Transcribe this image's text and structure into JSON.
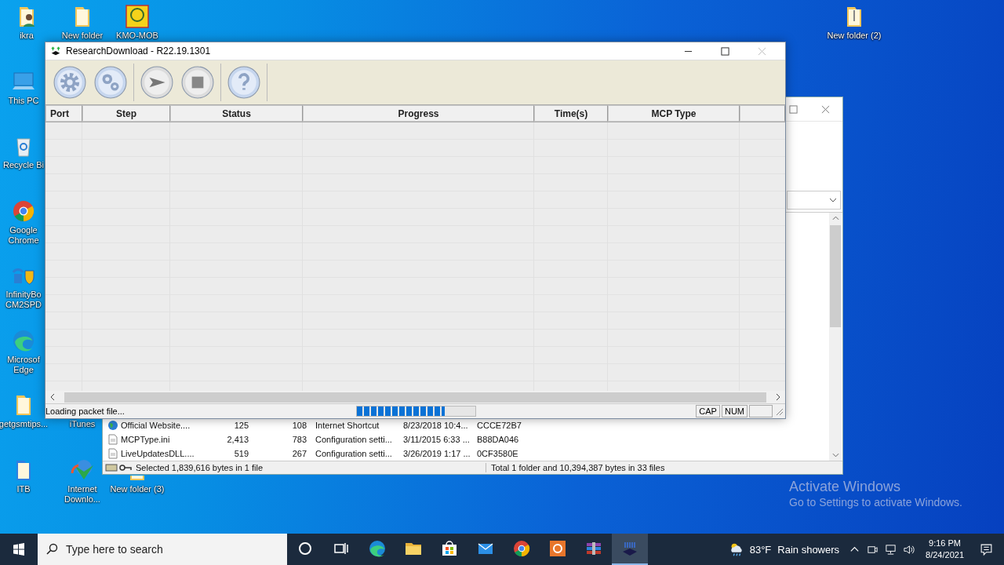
{
  "desktop_icons": [
    {
      "label": "ikra",
      "kind": "user-folder"
    },
    {
      "label": "New folder",
      "kind": "folder"
    },
    {
      "label": "KMO-MOB",
      "kind": "yellow-app"
    },
    {
      "label": "New folder (2)",
      "kind": "zip-folder"
    },
    {
      "label": "This PC",
      "kind": "computer"
    },
    {
      "label": "Recycle Bi",
      "kind": "recycle-bin"
    },
    {
      "label": "Google Chrome",
      "kind": "chrome"
    },
    {
      "label": "InfinityBo CM2SPD",
      "kind": "shield-app"
    },
    {
      "label": "Microsof Edge",
      "kind": "edge"
    },
    {
      "label": "getgsmtips...",
      "kind": "folder"
    },
    {
      "label": "iTunes"
    },
    {
      "label": "ITB",
      "kind": "blue-folder"
    },
    {
      "label": "Internet Downlo...",
      "kind": "download-app"
    },
    {
      "label": "New folder (3)",
      "kind": "folder"
    }
  ],
  "explorer_window": {
    "files": [
      {
        "kind": "web",
        "name": "Official Website....",
        "column_2": "125",
        "column_3": "108",
        "column_4": "Internet Shortcut",
        "column_5": "8/23/2018 10:4...",
        "column_6": "CCCE72B7"
      },
      {
        "kind": "file",
        "name": "MCPType.ini",
        "column_2": "2,413",
        "column_3": "783",
        "column_4": "Configuration setti...",
        "column_5": "3/11/2015 6:33 ...",
        "column_6": "B88DA046"
      },
      {
        "kind": "file",
        "name": "LiveUpdatesDLL....",
        "column_2": "519",
        "column_3": "267",
        "column_4": "Configuration setti...",
        "column_5": "3/26/2019 1:17 ...",
        "column_6": "0CF3580E"
      }
    ],
    "status_left": "Selected 1,839,616 bytes in 1 file",
    "status_right": "Total 1 folder and 10,394,387 bytes in 33 files"
  },
  "main_window": {
    "title": "ResearchDownload - R22.19.1301",
    "toolbar": [
      {
        "kind": "gear"
      },
      {
        "kind": "gears"
      },
      {
        "kind": "play"
      },
      {
        "kind": "stop"
      },
      {
        "kind": "help"
      }
    ],
    "columns": [
      "Port",
      "Step",
      "Status",
      "Progress",
      "Time(s)",
      "MCP Type"
    ],
    "status": {
      "message": "Loading packet file...",
      "level": 0.74,
      "panes": [
        "CAP",
        "NUM"
      ]
    }
  },
  "activation": {
    "title": "Activate Windows",
    "hint": "Go to Settings to activate Windows."
  },
  "taskbar": {
    "search": {
      "placeholder": "Type here to search"
    },
    "apps": [
      {
        "kind": "cortana",
        "selected": false
      },
      {
        "kind": "task-view",
        "selected": false
      },
      {
        "kind": "edge",
        "selected": false
      },
      {
        "kind": "explorer",
        "selected": false
      },
      {
        "kind": "store",
        "selected": false
      },
      {
        "kind": "mail",
        "selected": false
      },
      {
        "kind": "chrome",
        "selected": false
      },
      {
        "kind": "orange-app",
        "selected": false
      },
      {
        "kind": "archive",
        "selected": false
      },
      {
        "kind": "research",
        "selected": true
      }
    ],
    "weather": {
      "temperature": "83°F",
      "condition": "Rain showers"
    },
    "time": "9:16 PM",
    "date": "8/24/2021"
  }
}
